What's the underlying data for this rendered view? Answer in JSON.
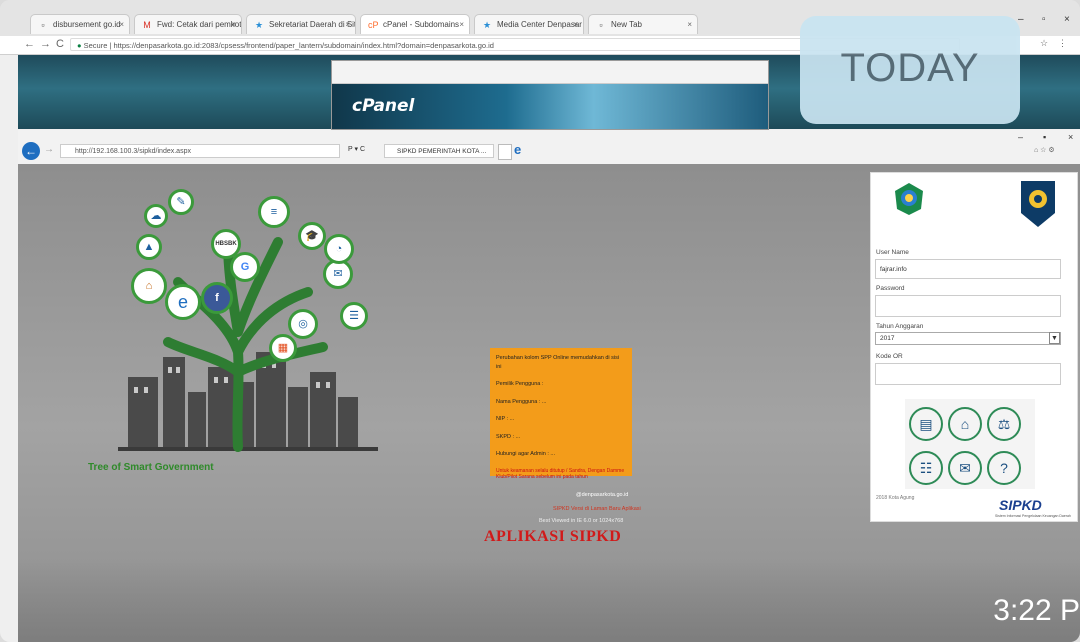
{
  "outer_browser": {
    "tabs": [
      {
        "label": "disbursement go.id",
        "icon": "page-icon"
      },
      {
        "label": "Fwd: Cetak dari pemkot",
        "icon": "gmail-icon"
      },
      {
        "label": "Sekretariat Daerah di Situs",
        "icon": "star-icon"
      },
      {
        "label": "cPanel - Subdomains",
        "icon": "cpanel-icon"
      },
      {
        "label": "Media Center Denpasar",
        "icon": "star-icon"
      },
      {
        "label": "New Tab",
        "icon": "page-icon"
      }
    ],
    "secure_label": "Secure",
    "url": "https://denpasarkota.go.id:2083/cpsess/frontend/paper_lantern/subdomain/index.html?domain=denpasarkota.go.id"
  },
  "cpanel_logo": "cPanel",
  "today_overlay": "TODAY",
  "inner_browser": {
    "url": "http://192.168.100.3/sipkd/index.aspx",
    "search_hint": "P ▾ C",
    "tab_title": "SIPKD PEMERINTAH KOTA ..."
  },
  "tree": {
    "caption": "Tree of Smart Government",
    "leaves": [
      "e",
      "f",
      "G",
      "HBSBK",
      "≡",
      "✉",
      "⌂",
      "◎",
      "☰",
      "✓",
      "▲"
    ]
  },
  "notice": {
    "line1": "Perubahan kolom SPP Online memudahkan di sisi ini",
    "line2": "Pemilik Pengguna :",
    "line3": "Nama Pengguna : ...",
    "line4": "NIP : ...",
    "line5": "SKPD : ...",
    "line6": "Hubungi agar Admin : ...",
    "warning": "Untuk keamanan selalu ditutup / Sandra, Dengan Damme Klub/Pilot Sarana sebelum ini pada tahun"
  },
  "footer_links": {
    "email": "@denpasarkota.go.id",
    "red_note": "SIPKD Versi di Laman Baru Aplikasi",
    "white_note": "Best Viewed in IE 6.0 or 1024x768"
  },
  "app_title": "APLIKASI SIPKD",
  "login": {
    "username_label": "User Name",
    "username_value": "fajrar.info",
    "password_label": "Password",
    "year_label": "Tahun Anggaran",
    "year_value": "2017",
    "code_label": "Kode OR",
    "footer_left": "2018 Kota Agung",
    "brand": "SIPKD",
    "brand_sub": "Sistem Informasi Pengelolaan Keuangan Daerah"
  },
  "video_clock": "3:22 P"
}
